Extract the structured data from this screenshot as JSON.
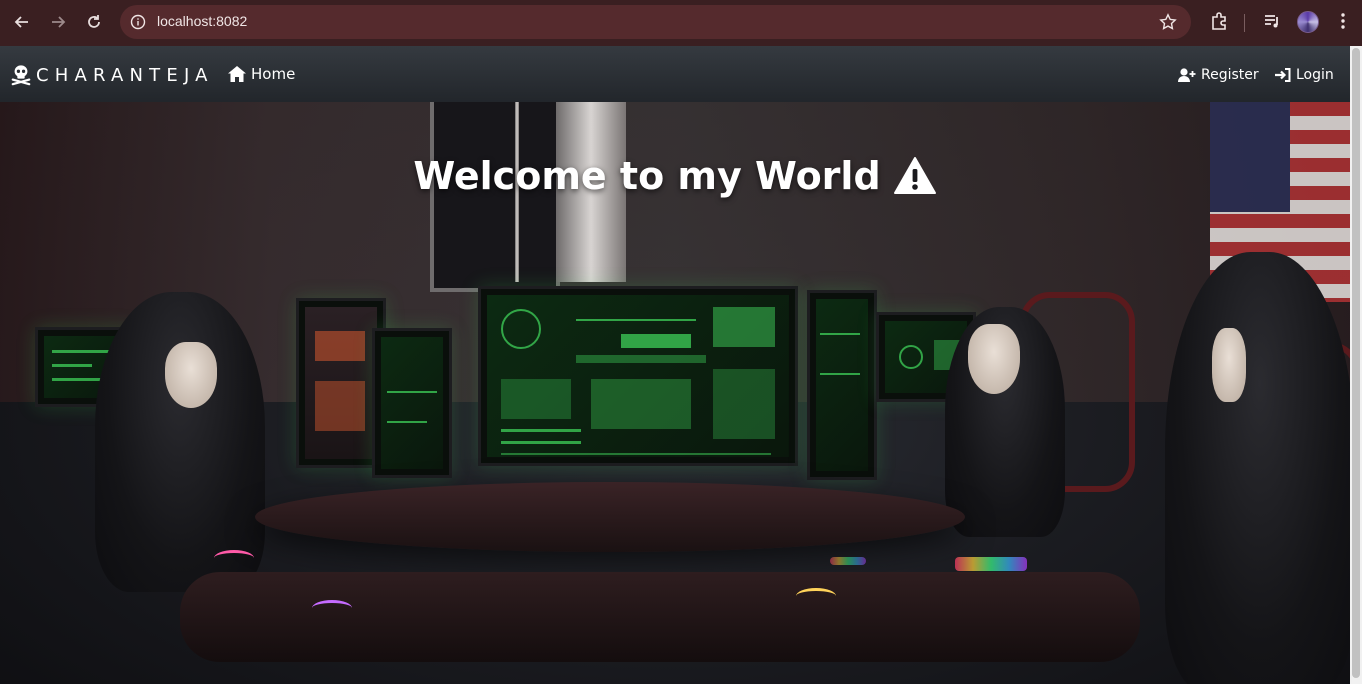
{
  "browser": {
    "url": "localhost:8082",
    "icons": [
      "back-arrow-icon",
      "forward-arrow-icon",
      "reload-icon",
      "info-icon",
      "star-icon",
      "extensions-icon",
      "media-queue-icon",
      "profile-avatar",
      "kebab-menu-icon"
    ]
  },
  "navbar": {
    "brand": "CHARANTEJA",
    "brand_icon": "skull-crossbones-icon",
    "home_label": "Home",
    "register_label": "Register",
    "login_label": "Login"
  },
  "hero": {
    "title": "Welcome to my World",
    "title_icon": "warning-triangle-icon"
  },
  "colors": {
    "browser_frame": "#3a1f21",
    "omnibox": "#552a2d",
    "navbar_top": "#353a40",
    "navbar_bottom": "#22262b",
    "text": "#ffffff"
  }
}
